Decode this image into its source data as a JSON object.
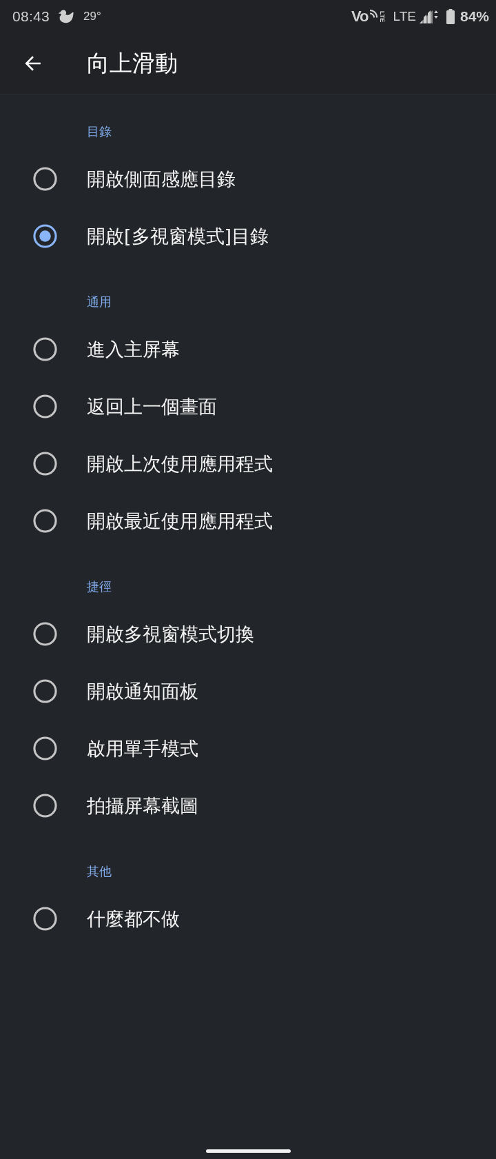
{
  "status_bar": {
    "time": "08:43",
    "temperature": "29°",
    "call_badge": {
      "text": "Vo",
      "sub": "LTE"
    },
    "network": "LTE",
    "battery": "84%"
  },
  "app_bar": {
    "title": "向上滑動"
  },
  "sections": [
    {
      "header": "目錄",
      "options": [
        {
          "label": "開啟側面感應目錄",
          "selected": false
        },
        {
          "label": "開啟[多視窗模式]目錄",
          "selected": true
        }
      ]
    },
    {
      "header": "通用",
      "options": [
        {
          "label": "進入主屏幕",
          "selected": false
        },
        {
          "label": "返回上一個畫面",
          "selected": false
        },
        {
          "label": "開啟上次使用應用程式",
          "selected": false
        },
        {
          "label": "開啟最近使用應用程式",
          "selected": false
        }
      ]
    },
    {
      "header": "捷徑",
      "options": [
        {
          "label": "開啟多視窗模式切換",
          "selected": false
        },
        {
          "label": "開啟通知面板",
          "selected": false
        },
        {
          "label": "啟用單手模式",
          "selected": false
        },
        {
          "label": "拍攝屏幕截圖",
          "selected": false
        }
      ]
    },
    {
      "header": "其他",
      "options": [
        {
          "label": "什麼都不做",
          "selected": false
        }
      ]
    }
  ]
}
